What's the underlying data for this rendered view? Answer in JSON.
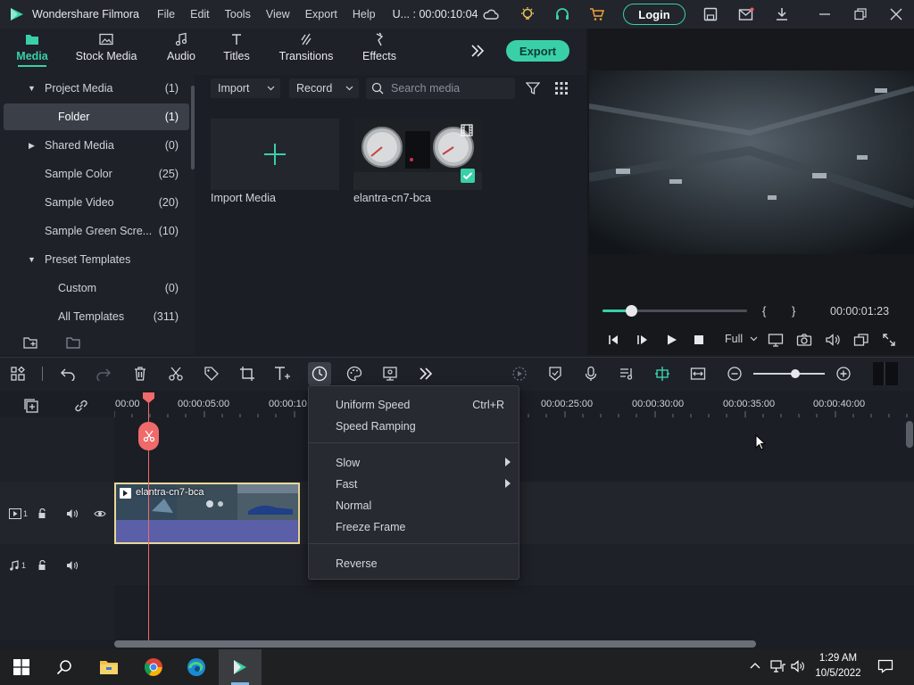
{
  "app": {
    "name": "Wondershare Filmora",
    "project": "U... : 00:00:10:04"
  },
  "menu": [
    "File",
    "Edit",
    "Tools",
    "View",
    "Export",
    "Help"
  ],
  "titlebar": {
    "login_label": "Login"
  },
  "media_tabs": [
    {
      "label": "Media",
      "icon": "folder-icon",
      "active": true
    },
    {
      "label": "Stock Media",
      "icon": "image-icon"
    },
    {
      "label": "Audio",
      "icon": "music-note-icon"
    },
    {
      "label": "Titles",
      "icon": "text-icon"
    },
    {
      "label": "Transitions",
      "icon": "transition-icon"
    },
    {
      "label": "Effects",
      "icon": "effects-icon"
    }
  ],
  "export_label": "Export",
  "sidebar": {
    "items": [
      {
        "label": "Project Media",
        "count": "(1)",
        "expand": "down"
      },
      {
        "label": "Folder",
        "count": "(1)",
        "selected": true
      },
      {
        "label": "Shared Media",
        "count": "(0)",
        "expand": "right"
      },
      {
        "label": "Sample Color",
        "count": "(25)"
      },
      {
        "label": "Sample Video",
        "count": "(20)"
      },
      {
        "label": "Sample Green Scre...",
        "count": "(10)"
      },
      {
        "label": "Preset Templates",
        "count": "",
        "expand": "down"
      },
      {
        "label": "Custom",
        "count": "(0)"
      },
      {
        "label": "All Templates",
        "count": "(311)"
      }
    ]
  },
  "media_toolbar": {
    "import_label": "Import",
    "record_label": "Record",
    "search_placeholder": "Search media"
  },
  "media_items": [
    {
      "label": "Import Media"
    },
    {
      "label": "elantra-cn7-bca"
    }
  ],
  "preview": {
    "timecode": "00:00:01:23",
    "quality": "Full",
    "progress": 0.2
  },
  "timeline": {
    "ruler": [
      "00:00",
      "00:00:05:00",
      "00:00:10",
      "00:00:25:00",
      "00:00:30:00",
      "00:00:35:00",
      "00:00:40:00"
    ],
    "clip_label": "elantra-cn7-bca",
    "video_track": "1",
    "audio_track": "1"
  },
  "speed_menu": {
    "items": [
      {
        "label": "Uniform Speed",
        "shortcut": "Ctrl+R"
      },
      {
        "label": "Speed Ramping"
      },
      {
        "label": "Slow",
        "submenu": true
      },
      {
        "label": "Fast",
        "submenu": true
      },
      {
        "label": "Normal"
      },
      {
        "label": "Freeze Frame"
      },
      {
        "label": "Reverse"
      }
    ]
  },
  "taskbar": {
    "time": "1:29 AM",
    "date": "10/5/2022"
  },
  "colors": {
    "accent": "#39d0a8",
    "playhead": "#f06a6a",
    "clip_border": "#e8d89a"
  }
}
